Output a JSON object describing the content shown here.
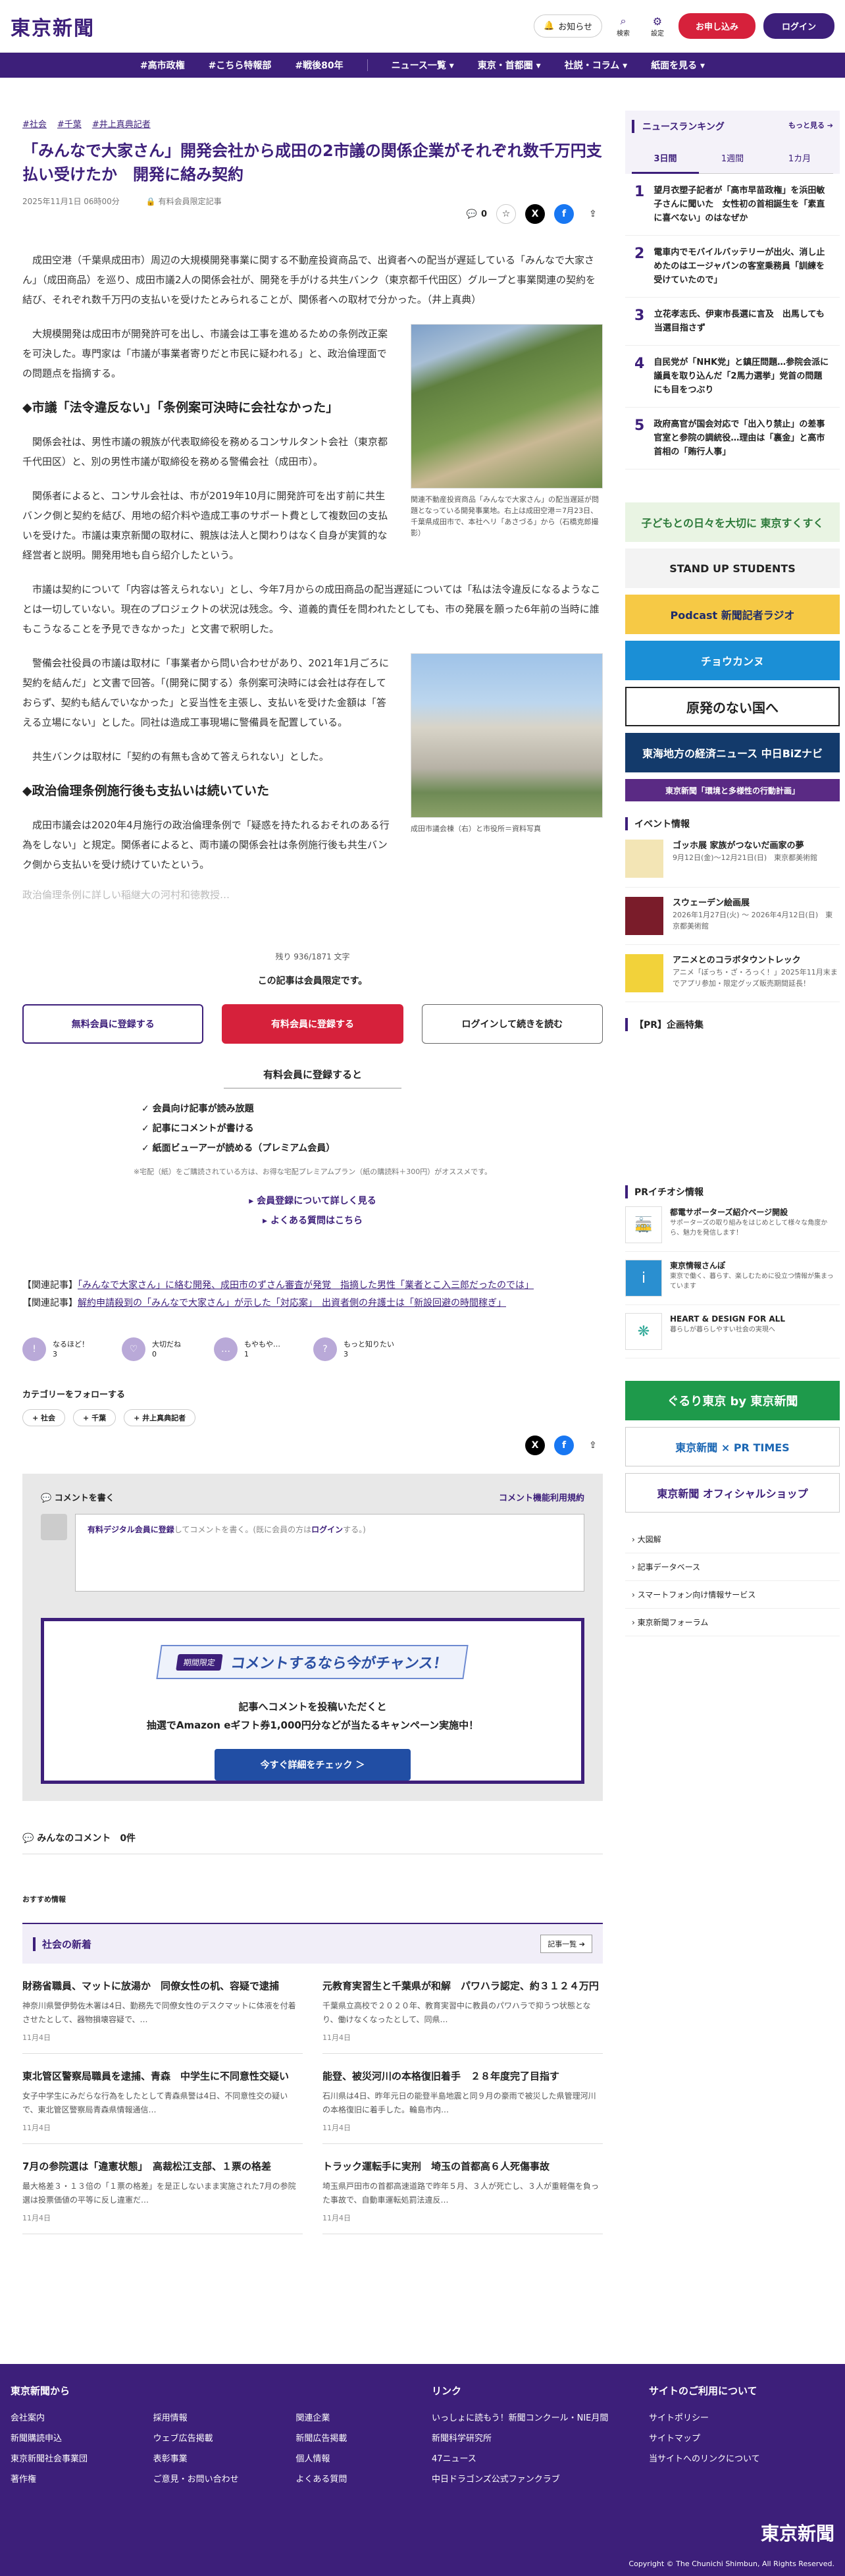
{
  "header": {
    "logo": "東京新聞",
    "notice": "お知らせ",
    "search": "検索",
    "settings": "設定",
    "signup": "お申し込み",
    "login": "ログイン"
  },
  "nav": [
    "#高市政権",
    "#こちら特報部",
    "#戦後80年",
    "ニュース一覧 ▾",
    "東京・首都圏 ▾",
    "社説・コラム ▾",
    "紙面を見る ▾"
  ],
  "article": {
    "tags": [
      "#社会",
      "#千葉",
      "#井上真典記者"
    ],
    "title": "「みんなで大家さん」開発会社から成田の2市議の関係企業がそれぞれ数千万円支払い受けたか　開発に絡み契約",
    "date": "2025年11月1日 06時00分",
    "members_label": "有料会員限定記事",
    "comment_count": "0",
    "p1": "成田空港（千葉県成田市）周辺の大規模開発事業に関する不動産投資商品で、出資者への配当が遅延している「みんなで大家さん」（成田商品）を巡り、成田市議2人の関係会社が、開発を手がける共生バンク（東京都千代田区）グループと事業関連の契約を結び、それぞれ数千万円の支払いを受けたとみられることが、関係者への取材で分かった。（井上真典）",
    "p2": "大規模開発は成田市が開発許可を出し、市議会は工事を進めるための条例改正案を可決した。専門家は「市議が事業者寄りだと市民に疑われる」と、政治倫理面での問題点を指摘する。",
    "h1": "◆市議「法令違反ない」「条例案可決時に会社なかった」",
    "p3": "関係会社は、男性市議の親族が代表取締役を務めるコンサルタント会社（東京都千代田区）と、別の男性市議が取締役を務める警備会社（成田市）。",
    "p4": "関係者によると、コンサル会社は、市が2019年10月に開発許可を出す前に共生バンク側と契約を結び、用地の紹介料や造成工事のサポート費として複数回の支払いを受けた。市議は東京新聞の取材に、親族は法人と関わりはなく自身が実質的な経営者と説明。開発用地も自ら紹介したという。",
    "p5": "市議は契約について「内容は答えられない」とし、今年7月からの成田商品の配当遅延については「私は法令違反になるようなことは一切していない。現在のプロジェクトの状況は残念。今、道義的責任を問われたとしても、市の発展を願った6年前の当時に誰もこうなることを予見できなかった」と文書で釈明した。",
    "p6": "警備会社役員の市議は取材に「事業者から問い合わせがあり、2021年1月ごろに契約を結んだ」と文書で回答。「(開発に関する）条例案可決時には会社は存在しておらず、契約も結んでいなかった」と妥当性を主張し、支払いを受けた金額は「答える立場にない」とした。同社は造成工事現場に警備員を配置している。",
    "p7": "共生バンクは取材に「契約の有無も含めて答えられない」とした。",
    "h2": "◆政治倫理条例施行後も支払いは続いていた",
    "p8": "成田市議会は2020年4月施行の政治倫理条例で「疑惑を持たれるおそれのある行為をしない」と規定。関係者によると、両市議の関係会社は条例施行後も共生バンク側から支払いを受け続けていたという。",
    "fade": "政治倫理条例に詳しい稲継大の河村和徳教授…",
    "cap1": "関連不動産投資商品「みんなで大家さん」の配当遅延が問題となっている開発事業地。右上は成田空港＝7月23日、千葉県成田市で、本社ヘリ「あさづる」から（石橋克郎撮影）",
    "cap2": "成田市議会棟（右）と市役所＝資料写真"
  },
  "paywall": {
    "remain": "残り 936/1871 文字",
    "notice": "この記事は会員限定です。",
    "free": "無料会員に登録する",
    "paid": "有料会員に登録する",
    "login": "ログインして続きを読む",
    "benefits_title": "有料会員に登録すると",
    "benefits": [
      "会員向け記事が読み放題",
      "記事にコメントが書ける",
      "紙面ビューアーが読める（プレミアム会員）"
    ],
    "note": "※宅配（紙）をご購読されている方は、お得な宅配プレミアムプラン（紙の購読料＋300円）がオススメです。",
    "link1": "会員登録について詳しく見る",
    "link2": "よくある質問はこちら"
  },
  "related": [
    {
      "pre": "【関連記事】",
      "text": "「みんなで大家さん」に絡む開発、成田市のずさん審査が発覚　指摘した男性「業者とこ入三郎だったのでは」"
    },
    {
      "pre": "【関連記事】",
      "text": "解約申請殺到の「みんなで大家さん」が示した「対応案」　出資者側の弁護士は「新設回避の時間稼ぎ」"
    }
  ],
  "reactions": [
    {
      "icon": "!",
      "label": "なるほど！",
      "count": "3"
    },
    {
      "icon": "♡",
      "label": "大切だね",
      "count": "0"
    },
    {
      "icon": "…",
      "label": "もやもや…",
      "count": "1"
    },
    {
      "icon": "?",
      "label": "もっと知りたい",
      "count": "3"
    }
  ],
  "categories": {
    "title": "カテゴリーをフォローする",
    "items": [
      "+ 社会",
      "+ 千葉",
      "+ 井上真典記者"
    ]
  },
  "comments": {
    "title": "コメントを書く",
    "terms": "コメント機能利用規約",
    "placeholder_pre": "有料デジタル会員に登録",
    "placeholder_mid": "してコメントを書く。(既に会員の方は",
    "placeholder_login": "ログイン",
    "placeholder_post": "する。)",
    "badge": "期間限定",
    "banner": "コメントするなら今がチャンス！",
    "desc1": "記事へコメントを投稿いただくと",
    "desc2": "抽選でAmazon eギフト券1,000円分などが当たるキャンペーン実施中！",
    "btn": "今すぐ詳細をチェック ＞",
    "all": "みんなのコメント",
    "count": "0件"
  },
  "recommend": "おすすめ情報",
  "news": {
    "title": "社会の新着",
    "more": "記事一覧 ➔",
    "items": [
      {
        "h": "財務省職員、マットに放湯か　同僚女性の机、容疑で逮捕",
        "d": "神奈川県警伊勢佐木署は4日、勤務先で同僚女性のデスクマットに体液を付着させたとして、器物損壊容疑で、…",
        "dt": "11月4日"
      },
      {
        "h": "元教育実習生と千葉県が和解　パワハラ認定、約３１２４万円",
        "d": "千葉県立高校で２０２０年、教育実習中に教員のパワハラで抑うつ状態となり、働けなくなったとして、同県…",
        "dt": "11月4日"
      },
      {
        "h": "東北管区警察局職員を逮捕、青森　中学生に不同意性交疑い",
        "d": "女子中学生にみだらな行為をしたとして青森県警は4日、不同意性交の疑いで、東北管区警察局青森県情報通信…",
        "dt": "11月4日"
      },
      {
        "h": "能登、被災河川の本格復旧着手　２８年度完了目指す",
        "d": "石川県は4日、昨年元日の能登半島地震と同９月の豪雨で被災した県管理河川の本格復旧に着手した。輪島市内…",
        "dt": "11月4日"
      },
      {
        "h": "7月の参院選は「違憲状態」　高裁松江支部、１票の格差",
        "d": "最大格差３・１３倍の「１票の格差」を是正しないまま実施された7月の参院選は投票価値の平等に反し違憲だ…",
        "dt": "11月4日"
      },
      {
        "h": "トラック運転手に実刑　埼玉の首都高６人死傷事故",
        "d": "埼玉県戸田市の首都高速道路で昨年５月、３人が死亡し、３人が重軽傷を負った事故で、自動車運転処罰法違反…",
        "dt": "11月4日"
      }
    ]
  },
  "ranking": {
    "title": "ニュースランキング",
    "more": "もっと見る ➔",
    "tabs": [
      "3日間",
      "1週間",
      "1カ月"
    ],
    "items": [
      {
        "n": "1",
        "t": "望月衣塑子記者が「高市早苗政権」を浜田敏子さんに聞いた　女性初の首相誕生を「素直に喜べない」のはなぜか"
      },
      {
        "n": "2",
        "t": "電車内でモバイルバッテリーが出火、消し止めたのはエージャパンの客室乗務員「訓練を受けていたので」"
      },
      {
        "n": "3",
        "t": "立花孝志氏、伊東市長選に言及　出馬しても当選目指さず"
      },
      {
        "n": "4",
        "t": "自民党が「NHK党」と鎮圧問題…参院会派に議員を取り込んだ「2馬力選挙」党首の問題にも目をつぶり"
      },
      {
        "n": "5",
        "t": "政府高官が国会対応で「出入り禁止」の差事官室と参院の調統役…理由は「裏金」と高市首相の「賄行人事」"
      }
    ]
  },
  "banners": [
    "子どもとの日々を大切に 東京すくすく",
    "STAND UP STUDENTS",
    "Podcast 新聞記者ラジオ",
    "チョウカンヌ",
    "原発のない国へ",
    "東海地方の経済ニュース 中日BiZナビ",
    "東京新聞「環境と多様性の行動計画」"
  ],
  "events": {
    "title": "イベント情報",
    "items": [
      {
        "t": "ゴッホ展 家族がつないだ画家の夢",
        "s": "9月12日(金)～12月21日(日)　東京都美術館"
      },
      {
        "t": "スウェーデン絵画展",
        "s": "2026年1月27日(火) ～ 2026年4月12日(日)　東京都美術館"
      },
      {
        "t": "アニメとのコラボタウントレック",
        "s": "アニメ「ぼっち・ざ・ろっく！」2025年11月末までアプリ参加・限定グッズ販売期間延長！"
      }
    ]
  },
  "pr_title": "【PR】企画特集",
  "pr2": {
    "title": "PRイチオシ情報",
    "items": [
      {
        "t": "都電サポーターズ紹介ページ開設",
        "s": "サポーターズの取り組みをはじめとして様々な角度から、魅力を発信します！"
      },
      {
        "t": "東京情報さんぽ",
        "s": "東京で働く、暮らす、楽しむために役立つ情報が集まっています"
      },
      {
        "t": "HEART & DESIGN FOR ALL",
        "s": "暮らしが暮らしやすい社会の実現へ"
      }
    ]
  },
  "side_banners": [
    "ぐるり東京 by 東京新聞",
    "東京新聞 × PR TIMES",
    "東京新聞 オフィシャルショップ"
  ],
  "side_links": [
    "大図解",
    "記事データベース",
    "スマートフォン向け情報サービス",
    "東京新聞フォーラム"
  ],
  "footer": {
    "col1": "東京新聞から",
    "col1_items": [
      "会社案内",
      "採用情報",
      "関連企業",
      "新聞購読申込",
      "ウェブ広告掲載",
      "新聞広告掲載",
      "東京新聞社会事業団",
      "表彰事業",
      "個人情報",
      "著作権",
      "ご意見・お問い合わせ",
      "よくある質問"
    ],
    "col2": "リンク",
    "col2_items": [
      "いっしょに読もう！新聞コンクール・NIE月間",
      "新聞科学研究所",
      "47ニュース",
      "中日ドラゴンズ公式ファンクラブ"
    ],
    "col3": "サイトのご利用について",
    "col3_items": [
      "サイトポリシー",
      "サイトマップ",
      "当サイトへのリンクについて"
    ],
    "logo": "東京新聞",
    "copy": "Copyright © The Chunichi Shimbun, All Rights Reserved."
  },
  "colors": {
    "brand": "#3d1f7a",
    "accent": "#d6213b"
  }
}
